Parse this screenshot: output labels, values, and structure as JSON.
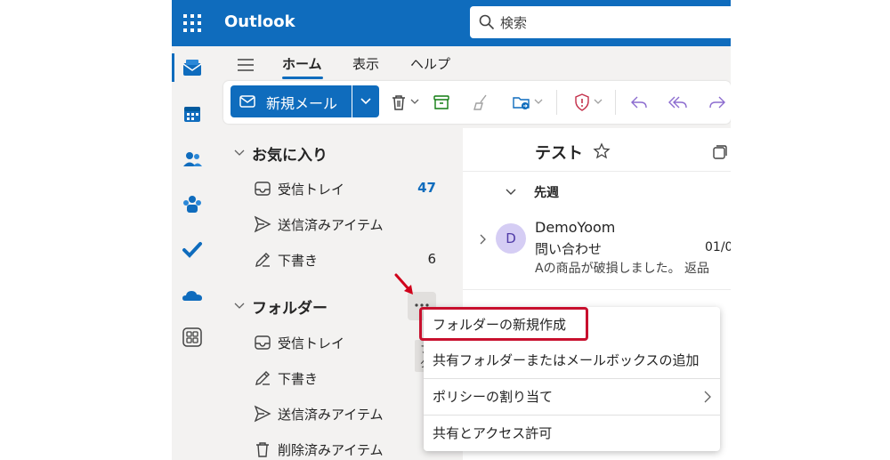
{
  "app": {
    "title": "Outlook"
  },
  "search": {
    "placeholder": "検索"
  },
  "ribbon": {
    "tabs": [
      "ホーム",
      "表示",
      "ヘルプ"
    ],
    "new_mail_label": "新規メール"
  },
  "favorites": {
    "title": "お気に入り",
    "items": [
      {
        "label": "受信トレイ",
        "count": "47",
        "icon": "inbox-icon"
      },
      {
        "label": "送信済みアイテム",
        "count": "",
        "icon": "send-icon"
      },
      {
        "label": "下書き",
        "count": "6",
        "icon": "draft-icon"
      }
    ]
  },
  "folders": {
    "title": "フォルダー",
    "tooltip": "フォルダー",
    "items": [
      {
        "label": "受信トレイ",
        "icon": "inbox-icon"
      },
      {
        "label": "下書き",
        "icon": "draft-icon"
      },
      {
        "label": "送信済みアイテム",
        "icon": "send-icon"
      },
      {
        "label": "削除済みアイテム",
        "icon": "trash-icon"
      }
    ]
  },
  "message_list": {
    "title": "テスト",
    "group": "先週",
    "messages": [
      {
        "avatar": "D",
        "sender": "DemoYoom",
        "subject": "問い合わせ",
        "date": "01/0",
        "preview": "Aの商品が破損しました。 返品"
      }
    ]
  },
  "context_menu": {
    "items": [
      "フォルダーの新規作成",
      "共有フォルダーまたはメールボックスの追加",
      "ポリシーの割り当て",
      "共有とアクセス許可"
    ]
  },
  "colors": {
    "brand": "#0f6cbd",
    "highlight": "#c8102e",
    "unread": "#0f6cbd"
  }
}
